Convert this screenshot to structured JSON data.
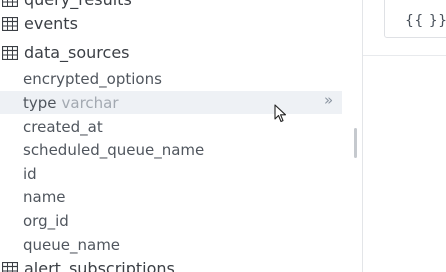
{
  "schema": {
    "tables": [
      {
        "name": "query_results"
      },
      {
        "name": "events"
      },
      {
        "name": "data_sources",
        "columns": [
          {
            "name": "encrypted_options",
            "type": ""
          },
          {
            "name": "type",
            "type": "varchar"
          },
          {
            "name": "created_at",
            "type": ""
          },
          {
            "name": "scheduled_queue_name",
            "type": ""
          },
          {
            "name": "id",
            "type": ""
          },
          {
            "name": "name",
            "type": ""
          },
          {
            "name": "org_id",
            "type": ""
          },
          {
            "name": "queue_name",
            "type": ""
          }
        ]
      },
      {
        "name": "alert_subscriptions"
      }
    ],
    "insert_icon": "»"
  },
  "editor": {
    "params_button_label": "{{ }}"
  },
  "icons": {
    "table": "table-grid-icon",
    "insert": "double-chevron-right-icon",
    "cursor": "mouse-pointer-icon"
  }
}
